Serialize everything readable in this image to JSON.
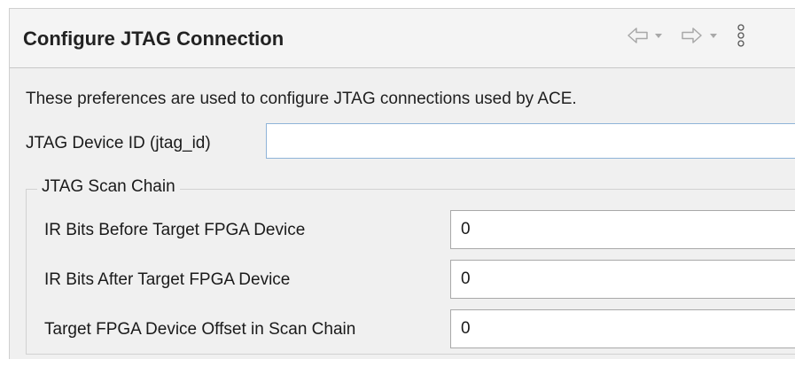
{
  "header": {
    "title": "Configure JTAG Connection",
    "icons": [
      "back-arrow-icon",
      "dropdown-arrow-icon",
      "forward-arrow-icon",
      "dropdown-arrow-icon",
      "view-menu-icon"
    ]
  },
  "description": "These preferences are used to configure JTAG connections used by ACE.",
  "device_id": {
    "label": "JTAG Device ID (jtag_id)",
    "value": ""
  },
  "scan_chain": {
    "group_label": "JTAG Scan Chain",
    "fields": [
      {
        "label": "IR Bits Before Target FPGA Device",
        "value": "0"
      },
      {
        "label": "IR Bits After Target FPGA Device",
        "value": "0"
      },
      {
        "label": "Target FPGA Device Offset in Scan Chain",
        "value": "0"
      }
    ]
  },
  "colors": {
    "panel_bg": "#f0f0f0",
    "input_focus_border": "#8fb4d8",
    "input_border": "#a9a9a9"
  }
}
